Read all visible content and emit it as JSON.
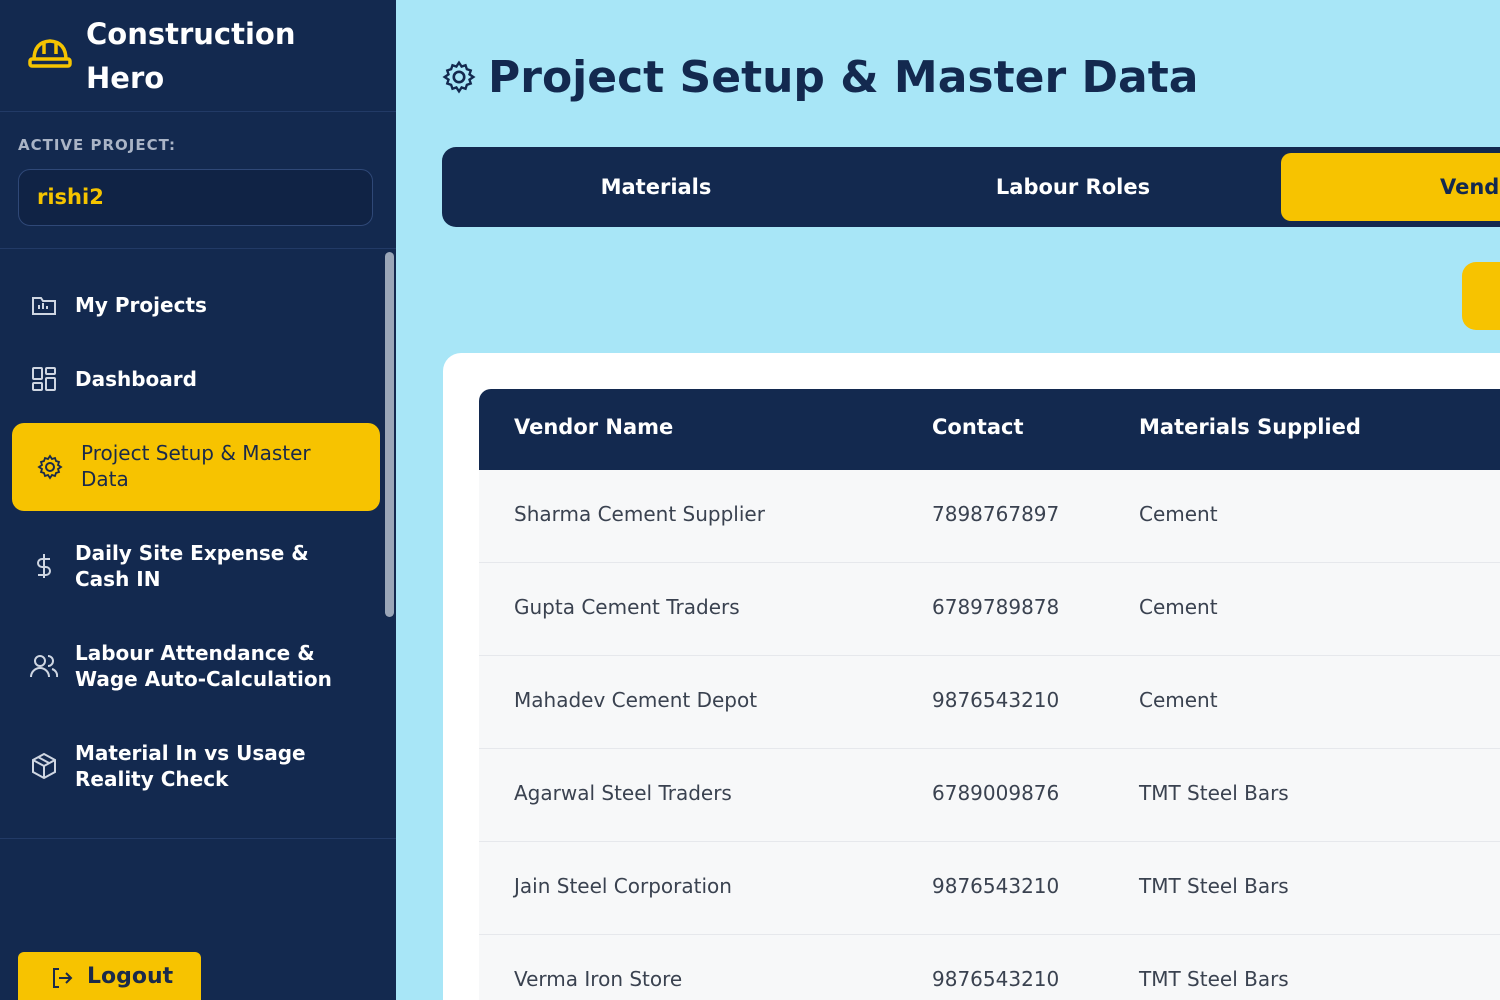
{
  "brand": {
    "title_line1": "Construction",
    "title_line2": "Hero",
    "icon": "hardhat-icon"
  },
  "active_project": {
    "label": "ACTIVE PROJECT:",
    "value": "rishi2"
  },
  "nav": [
    {
      "label": "My Projects",
      "icon": "folder-icon"
    },
    {
      "label": "Dashboard",
      "icon": "grid-icon"
    },
    {
      "label": "Project Setup & Master Data",
      "icon": "gear-icon",
      "active": true
    },
    {
      "label": "Daily Site Expense & Cash IN",
      "icon": "dollar-icon"
    },
    {
      "label": "Labour Attendance & Wage Auto-Calculation",
      "icon": "users-icon"
    },
    {
      "label": "Material In vs Usage Reality Check",
      "icon": "package-icon"
    }
  ],
  "logout_label": "Logout",
  "page": {
    "title": "Project Setup & Master Data"
  },
  "tabs": [
    {
      "label": "Materials"
    },
    {
      "label": "Labour Roles"
    },
    {
      "label": "Vend",
      "active": true
    }
  ],
  "table": {
    "headers": [
      "Vendor Name",
      "Contact",
      "Materials Supplied"
    ],
    "rows": [
      [
        "Sharma Cement Supplier",
        "7898767897",
        "Cement"
      ],
      [
        "Gupta Cement Traders",
        "6789789878",
        "Cement"
      ],
      [
        "Mahadev Cement Depot",
        "9876543210",
        "Cement"
      ],
      [
        "Agarwal Steel Traders",
        "6789009876",
        "TMT Steel Bars"
      ],
      [
        "Jain Steel Corporation",
        "9876543210",
        "TMT Steel Bars"
      ],
      [
        "Verma Iron Store",
        "9876543210",
        "TMT Steel Bars"
      ]
    ]
  },
  "colors": {
    "sidebar": "#13294f",
    "accent": "#f7c300",
    "background": "#a8e6f7"
  }
}
